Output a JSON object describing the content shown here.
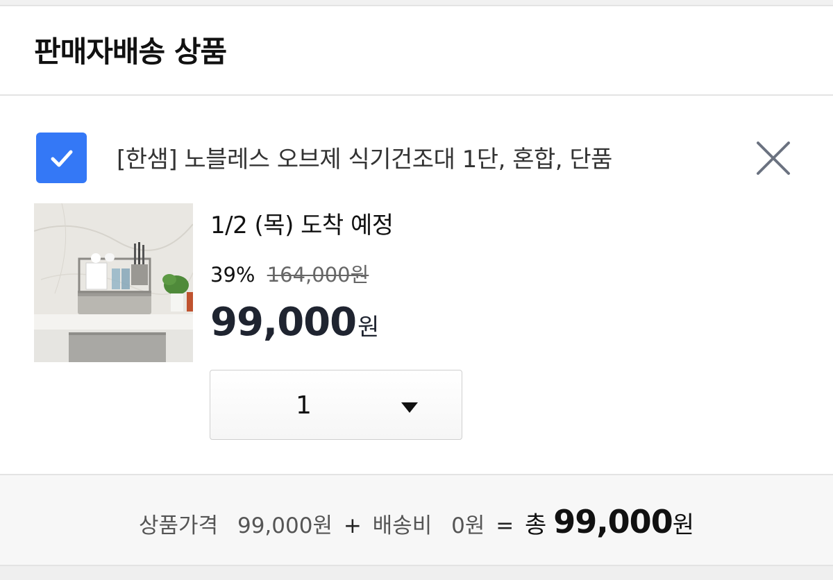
{
  "header": {
    "title": "판매자배송 상품"
  },
  "item": {
    "checked": true,
    "name": "[한샘] 노블레스 오브제 식기건조대 1단, 혼합, 단품",
    "arrival": "1/2 (목) 도착 예정",
    "discount_rate": "39%",
    "original_price": "164,000원",
    "sale_price": "99,000",
    "sale_price_unit": "원",
    "quantity": "1",
    "image_description": "dish-rack-product-photo"
  },
  "summary": {
    "product_price_label": "상품가격",
    "product_price": "99,000원",
    "plus": "+",
    "shipping_label": "배송비",
    "shipping_fee": "0원",
    "equals": "=",
    "total_label": "총",
    "total_amount": "99,000",
    "total_unit": "원"
  },
  "colors": {
    "checkbox": "#3478f6",
    "footer_bg": "#f7f7f7",
    "price_text": "#1f2430"
  }
}
